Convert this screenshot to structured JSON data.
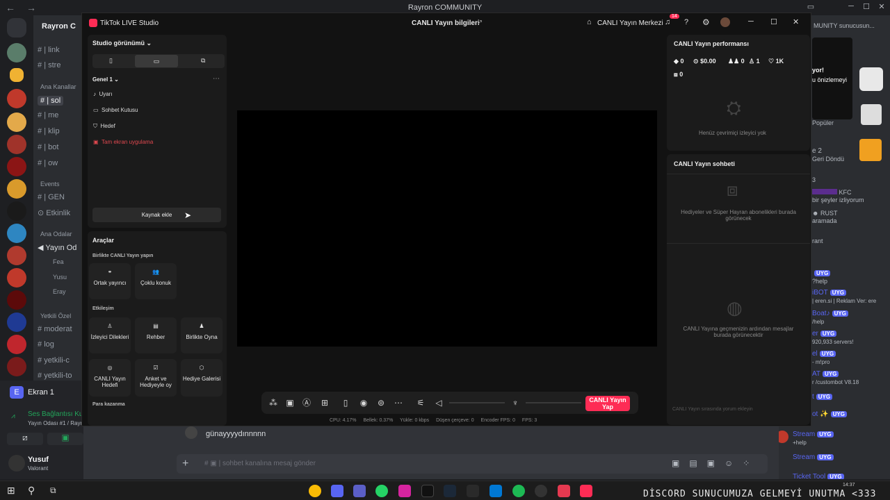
{
  "discord": {
    "window_title": "Rayron COMMUNITY",
    "server_name": "Rayron C",
    "channels": [
      "| link",
      "| stre",
      "| sol",
      "| me",
      "| klip",
      "| bot",
      "| ow",
      "| GEN",
      "Etkinlik",
      "Yayın Od",
      "Fea",
      "Yusu",
      "Eray",
      "moderat",
      "log",
      "yetkili-c",
      "yetkili-to"
    ],
    "categories": [
      "Ana Kanallar",
      "Events",
      "Ana Odalar",
      "Yetkili Özel"
    ],
    "voice": {
      "screen_label": "Ekran 1",
      "status": "Ses Bağlantısı Ku",
      "room": "Yayın Odası #1 / Rayro"
    },
    "user": {
      "name": "Yusuf",
      "activity": "Valorant"
    },
    "message_text": "günayyyydınnnnn",
    "input_placeholder": "sohbet kanalına mesaj gönder",
    "members_header": "MUNITY sunucusun...",
    "members": [
      {
        "name": "yor!",
        "sub": "u önizlemeyi"
      },
      {
        "name": "Popüler",
        "sub": ""
      },
      {
        "name": "e 2",
        "sub": "Geri Döndü"
      },
      {
        "name": "3",
        "sub": ""
      },
      {
        "name": "KFC",
        "sub": "bir şeyler izliyorum"
      },
      {
        "name": "RUST",
        "sub": "aramada"
      },
      {
        "name": "rant",
        "sub": ""
      },
      {
        "name": "UYG",
        "sub": "?help"
      },
      {
        "name": "iBOT",
        "sub": "| eren.si | Reklam Ver: ere"
      },
      {
        "name": "Boat♪",
        "sub": "/help"
      },
      {
        "name": "er",
        "sub": "920,933 servers!"
      },
      {
        "name": "el",
        "sub": "- m!pro"
      },
      {
        "name": "AT",
        "sub": "r /custombot V8.18"
      },
      {
        "name": "t",
        "sub": ""
      },
      {
        "name": "ot ✨",
        "sub": ""
      },
      {
        "name": "Stream",
        "sub": "+help"
      },
      {
        "name": "Stream",
        "sub": ""
      },
      {
        "name": "Ticket Tool",
        "sub": ""
      }
    ],
    "badge_label": "UYG"
  },
  "tiktok": {
    "app_title": "TikTok LIVE Studio",
    "stream_info": "CANLI Yayın bilgileri",
    "live_center": "CANLI Yayın Merkezi",
    "notif_count": "14",
    "studio_view": "Studio görünümü",
    "scene": "Genel 1",
    "sources": [
      {
        "label": "Uyarı",
        "icon": "bell-icon"
      },
      {
        "label": "Sohbet Kutusu",
        "icon": "chat-icon"
      },
      {
        "label": "Hedef",
        "icon": "shield-icon"
      },
      {
        "label": "Tam ekran uygulama",
        "icon": "screen-icon",
        "error": true
      }
    ],
    "add_source": "Kaynak ekle",
    "tools_title": "Araçlar",
    "collab_title": "Birlikte CANLI Yayın yapın",
    "collab_tools": [
      "Ortak yayıncı",
      "Çoklu konuk"
    ],
    "engage_title": "Etkileşim",
    "engage_tools": [
      "İzleyici Dilekleri",
      "Rehber",
      "Birlikte Oyna",
      "CANLI Yayın Hedefi",
      "Anket ve Hediyeyle oy",
      "Hediye Galerisi"
    ],
    "earn_title": "Para kazanma",
    "perf_title": "CANLI Yayın performansı",
    "perf_stats": [
      "0",
      "$0.00",
      "0",
      "1",
      "1K",
      "0"
    ],
    "no_viewers": "Henüz çevrimiçi izleyici yok",
    "chat_title": "CANLI Yayın sohbeti",
    "gifts_note": "Hediyeler ve Süper Hayran abonelikleri burada görünecek",
    "history_note": "CANLI Yayına geçmenizin ardından mesajlar burada görünecektir",
    "comment_placeholder": "CANLI Yayın sırasında yorum ekleyin",
    "go_live": "CANLI Yayın Yap",
    "stats": {
      "cpu": "CPU: 4.17%",
      "mem": "Bellek: 0.37%",
      "upload": "Yükle: 0 kbps",
      "dropped": "Düşen çerçeve: 0",
      "encoder": "Encoder FPS: 0",
      "fps": "FPS: 3"
    }
  },
  "taskbar": {
    "marquee": "DİSCORD SUNUCUMUZA GELMEYİ UNUTMA <333",
    "time": "14:37"
  },
  "colors": {
    "accent": "#fe2c55",
    "discord_blurple": "#5865f2"
  }
}
